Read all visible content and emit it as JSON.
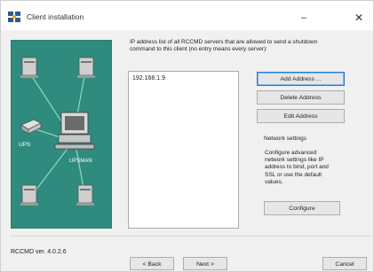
{
  "window": {
    "title": "Client installation",
    "minimize_glyph": "–",
    "close_glyph": "✕",
    "icon": "app-icon"
  },
  "graphic": {
    "background_color": "#2e8b7e",
    "ups_label": "UPS",
    "upsman_label": "UPSMAN"
  },
  "main": {
    "instruction": "IP address list of all RCCMD servers that are allowed to send a shutdown command to this client (no entry means every server):",
    "address_list": [
      "192.168.1.9"
    ],
    "add_button": "Add Address ...",
    "delete_button": "Delete Address",
    "edit_button": "Edit Address"
  },
  "network": {
    "label": "Network settings",
    "description": "Configure advanced network settings like IP address to bind, port and SSL or use the default values.",
    "configure_button": "Configure"
  },
  "footer": {
    "version": "RCCMD ver. 4.0.2.6",
    "back_button": "< Back",
    "next_button": "Next >",
    "cancel_button": "Cancel"
  }
}
